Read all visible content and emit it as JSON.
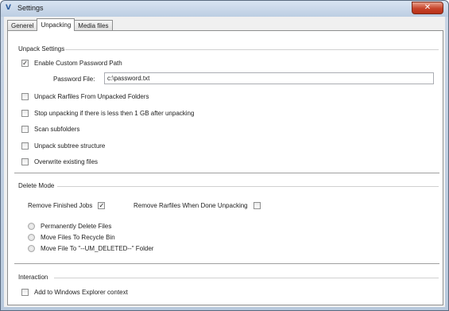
{
  "window": {
    "title": "Settings",
    "close_label": "✕"
  },
  "tabs": [
    {
      "label": "Generel",
      "active": false
    },
    {
      "label": "Unpacking",
      "active": true
    },
    {
      "label": "Media files",
      "active": false
    }
  ],
  "unpack": {
    "title": "Unpack Settings",
    "enable_custom_password": {
      "label": "Enable Custom Password Path",
      "checked": true
    },
    "password_file_label": "Password File:",
    "password_file_value": "c:\\password.txt",
    "unpack_rarfiles": {
      "label": "Unpack Rarfiles From Unpacked Folders",
      "checked": false
    },
    "stop_unpacking": {
      "label": "Stop unpacking if there is less then 1 GB after unpacking",
      "checked": false
    },
    "scan_subfolders": {
      "label": "Scan subfolders",
      "checked": false
    },
    "unpack_subtree": {
      "label": "Unpack subtree structure",
      "checked": false
    },
    "overwrite": {
      "label": "Overwrite existing files",
      "checked": false
    }
  },
  "delete_mode": {
    "title": "Delete Mode",
    "remove_finished": {
      "label": "Remove Finished Jobs",
      "checked": true
    },
    "remove_rarfiles": {
      "label": "Remove Rarfiles When Done Unpacking",
      "checked": false
    },
    "options": [
      {
        "label": "Permanently Delete Files"
      },
      {
        "label": "Move Files To Recycle Bin"
      },
      {
        "label": "Move File To \"--UM_DELETED--\" Folder"
      }
    ]
  },
  "interaction": {
    "title": "Interaction",
    "explorer_context": {
      "label": "Add to Windows Explorer context",
      "checked": false
    }
  },
  "check_glyph": "✓"
}
